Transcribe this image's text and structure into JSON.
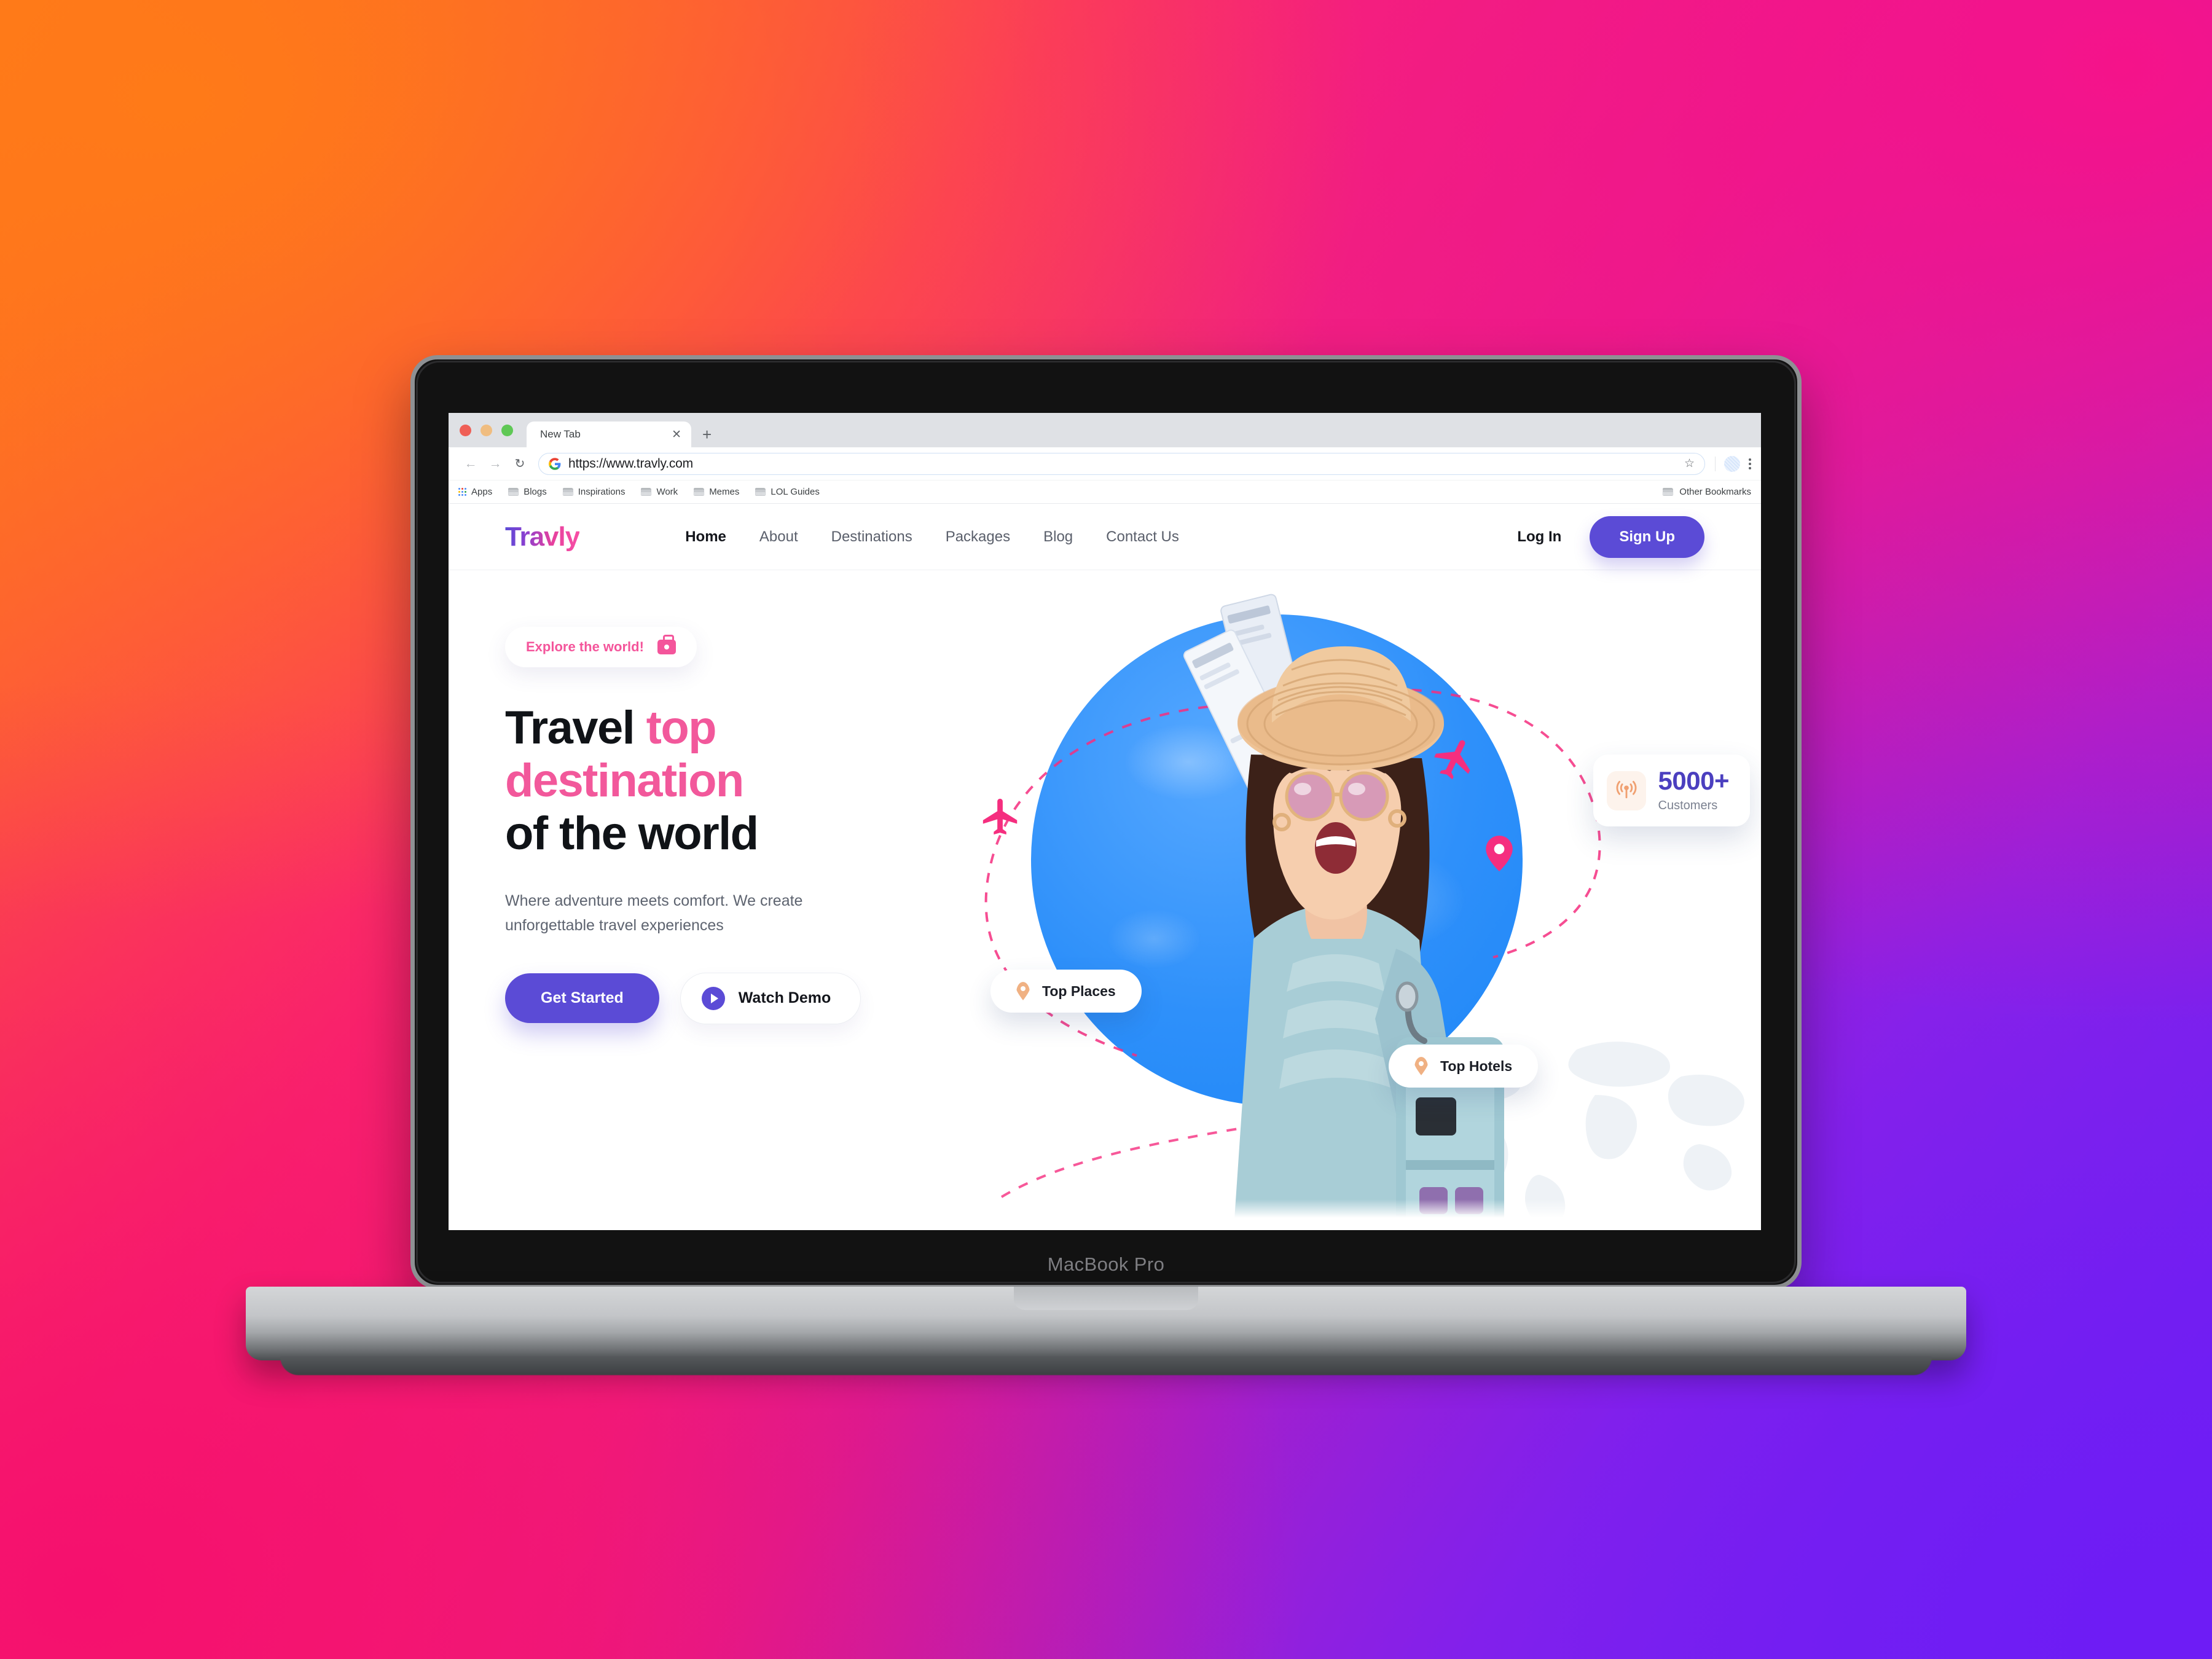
{
  "browser": {
    "tab_title": "New Tab",
    "tab_close_icon": "close-icon",
    "new_tab_icon": "plus-icon",
    "back_icon": "arrow-left-icon",
    "forward_icon": "arrow-right-icon",
    "reload_icon": "reload-icon",
    "url": "https://www.travly.com",
    "url_favicon": "google-g-icon",
    "bookmark_star_icon": "star-icon",
    "profile_icon": "avatar-icon",
    "menu_icon": "kebab-menu-icon",
    "bookmarks": [
      {
        "label": "Apps",
        "icon": "apps-grid-icon"
      },
      {
        "label": "Blogs",
        "icon": "folder-icon"
      },
      {
        "label": "Inspirations",
        "icon": "folder-icon"
      },
      {
        "label": "Work",
        "icon": "folder-icon"
      },
      {
        "label": "Memes",
        "icon": "folder-icon"
      },
      {
        "label": "LOL Guides",
        "icon": "folder-icon"
      }
    ],
    "other_bookmarks": {
      "label": "Other Bookmarks",
      "icon": "folder-icon"
    }
  },
  "device": {
    "label": "MacBook Pro"
  },
  "site": {
    "logo": "Travly",
    "nav": [
      {
        "label": "Home",
        "active": true
      },
      {
        "label": "About",
        "active": false
      },
      {
        "label": "Destinations",
        "active": false
      },
      {
        "label": "Packages",
        "active": false
      },
      {
        "label": "Blog",
        "active": false
      },
      {
        "label": "Contact Us",
        "active": false
      }
    ],
    "login_label": "Log In",
    "signup_label": "Sign Up",
    "hero": {
      "badge_text": "Explore the world!",
      "badge_icon": "suitcase-icon",
      "headline_line1_dark": "Travel ",
      "headline_line1_pink": "top",
      "headline_line2_pink": "destination",
      "headline_line3_dark": "of the world",
      "subtitle": "Where adventure meets comfort. We create unforgettable travel experiences",
      "primary_cta": "Get Started",
      "secondary_cta": "Watch Demo",
      "secondary_cta_icon": "play-circle-icon",
      "pill_top_places": "Top Places",
      "pill_top_hotels": "Top Hotels",
      "pill_icon": "map-pin-icon",
      "stat_value": "5000+",
      "stat_label": "Customers",
      "stat_icon": "broadcast-signal-icon"
    }
  },
  "colors": {
    "brand_purple": "#5B4BD6",
    "brand_pink": "#F2589B",
    "globe_blue": "#2E90FA",
    "accent_orange": "#F0B183",
    "dashed_pink": "#F52E7F",
    "text_dark": "#101317",
    "text_muted": "#5e6470"
  }
}
